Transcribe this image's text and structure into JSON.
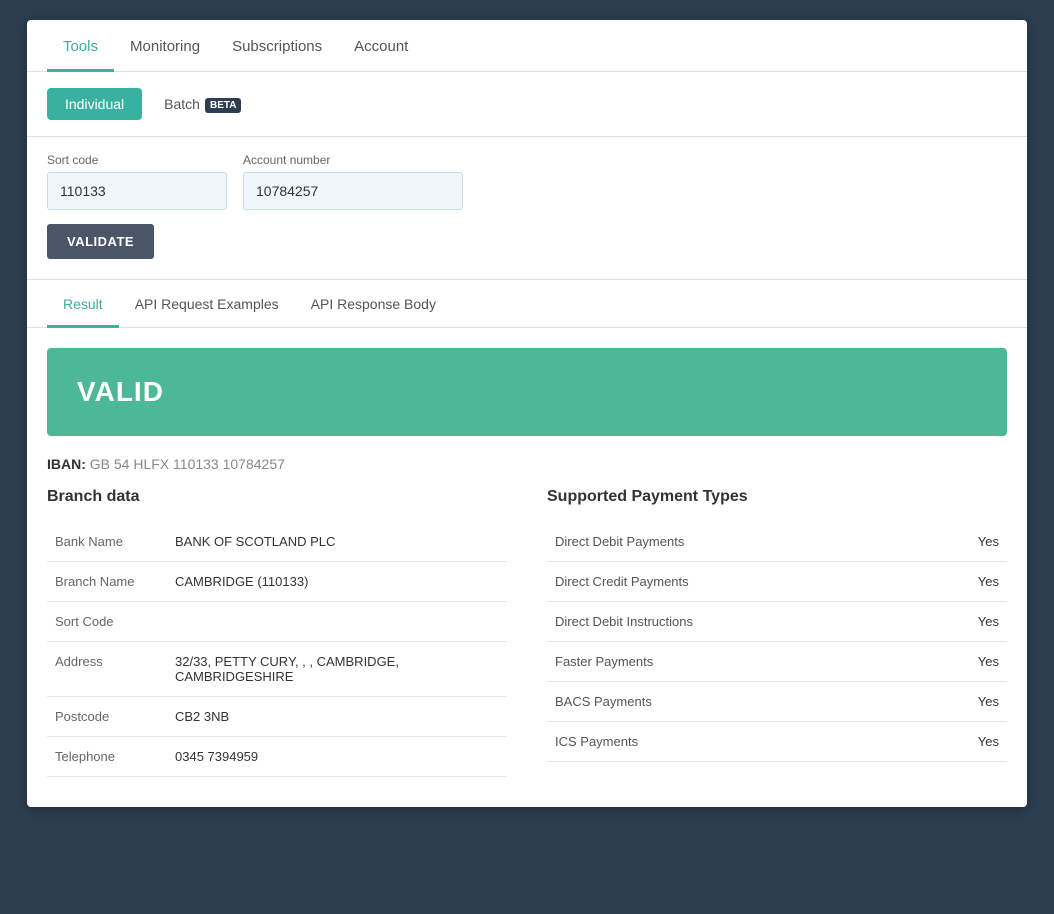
{
  "nav": {
    "items": [
      {
        "label": "Tools",
        "active": true
      },
      {
        "label": "Monitoring",
        "active": false
      },
      {
        "label": "Subscriptions",
        "active": false
      },
      {
        "label": "Account",
        "active": false
      }
    ]
  },
  "subtabs": {
    "items": [
      {
        "label": "Individual",
        "active": true
      },
      {
        "label": "Batch",
        "beta": true,
        "active": false
      }
    ],
    "beta_label": "BETA"
  },
  "form": {
    "sort_code_label": "Sort code",
    "sort_code_value": "110133",
    "account_number_label": "Account number",
    "account_number_value": "10784257",
    "validate_label": "VALIDATE"
  },
  "result_tabs": {
    "items": [
      {
        "label": "Result",
        "active": true
      },
      {
        "label": "API Request Examples",
        "active": false
      },
      {
        "label": "API Response Body",
        "active": false
      }
    ]
  },
  "result": {
    "valid_text": "VALID",
    "iban_label": "IBAN:",
    "iban_value": "GB 54 HLFX 110133 10784257"
  },
  "branch_data": {
    "title": "Branch data",
    "rows": [
      {
        "key": "Bank Name",
        "value": "BANK OF SCOTLAND PLC"
      },
      {
        "key": "Branch Name",
        "value": "CAMBRIDGE (110133)"
      },
      {
        "key": "Sort Code",
        "value": ""
      },
      {
        "key": "Address",
        "value": "32/33, PETTY CURY, , , CAMBRIDGE, CAMBRIDGESHIRE"
      },
      {
        "key": "Postcode",
        "value": "CB2 3NB"
      },
      {
        "key": "Telephone",
        "value": "0345 7394959"
      }
    ]
  },
  "payment_types": {
    "title": "Supported Payment Types",
    "rows": [
      {
        "label": "Direct Debit Payments",
        "value": "Yes"
      },
      {
        "label": "Direct Credit Payments",
        "value": "Yes"
      },
      {
        "label": "Direct Debit Instructions",
        "value": "Yes"
      },
      {
        "label": "Faster Payments",
        "value": "Yes"
      },
      {
        "label": "BACS Payments",
        "value": "Yes"
      },
      {
        "label": "ICS Payments",
        "value": "Yes"
      }
    ]
  }
}
